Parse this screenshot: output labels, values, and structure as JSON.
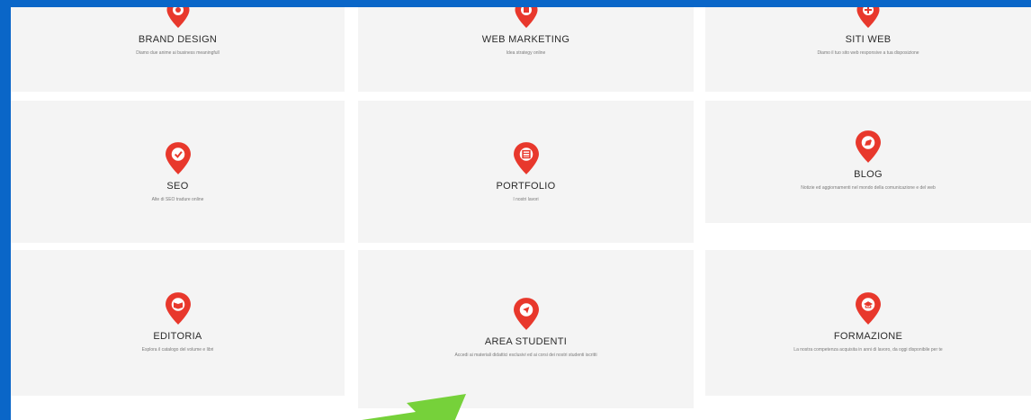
{
  "colors": {
    "frame": "#0a66c8",
    "card": "#f4f4f4",
    "pin": "#e8382c",
    "arrow": "#76d13a"
  },
  "cards": [
    {
      "title": "BRAND DESIGN",
      "desc": "Diamo due anime ai business meaningfull",
      "icon": "location-pin-icon"
    },
    {
      "title": "WEB MARKETING",
      "desc": "Idea strategy online",
      "icon": "location-pin-icon"
    },
    {
      "title": "SITI WEB",
      "desc": "Diamo il tuo sito web responsive a tua disposizione",
      "icon": "location-pin-icon"
    },
    {
      "title": "SEO",
      "desc": "Alte di SEO tradure online",
      "icon": "location-pin-icon"
    },
    {
      "title": "PORTFOLIO",
      "desc": "I nostri lavori",
      "icon": "location-pin-icon"
    },
    {
      "title": "BLOG",
      "desc": "Notizie ed aggiornamenti nel mondo della comunicazione e del web",
      "icon": "location-pin-icon"
    },
    {
      "title": "EDITORIA",
      "desc": "Esplora il catalogo del volume e libri",
      "icon": "location-pin-icon"
    },
    {
      "title": "AREA STUDENTI",
      "desc": "Accedi ai materiali didattici esclusivi ed ai corsi dei nostri studenti iscritti",
      "icon": "location-pin-icon"
    },
    {
      "title": "FORMAZIONE",
      "desc": "La nostra competenza acquisita in anni di lavoro, da oggi disponibile per te",
      "icon": "location-pin-icon"
    }
  ]
}
